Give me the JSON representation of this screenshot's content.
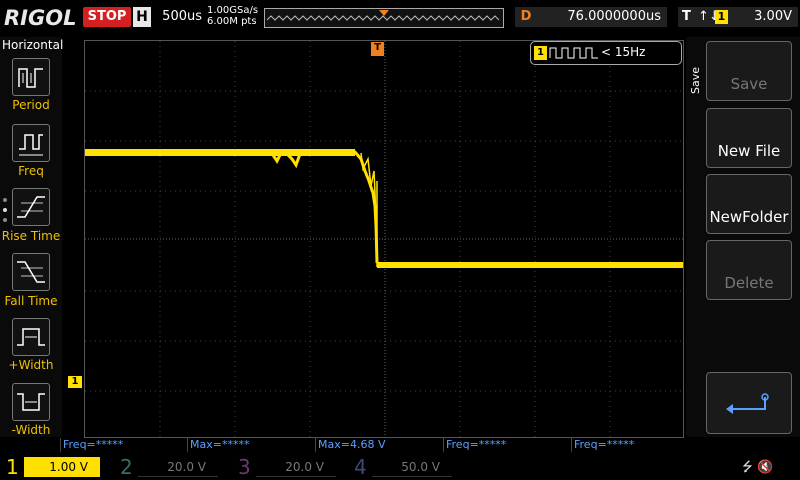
{
  "topbar": {
    "logo": "RIGOL",
    "run_state": "STOP",
    "horizontal_label": "H",
    "timebase": "500us",
    "sample_rate": "1.00GSa/s",
    "memory_depth": "6.00M pts",
    "delay_label": "D",
    "delay_value": "76.0000000us",
    "trigger_label": "T",
    "trigger_edge": "↑↓",
    "trigger_channel": "1",
    "trigger_level": "3.00V"
  },
  "left_menu": {
    "title": "Horizontal",
    "items": [
      {
        "label": "Period"
      },
      {
        "label": "Freq"
      },
      {
        "label": "Rise Time"
      },
      {
        "label": "Fall Time"
      },
      {
        "label": "+Width"
      },
      {
        "label": "-Width"
      }
    ]
  },
  "right_menu": {
    "title": "Save",
    "buttons": [
      {
        "label": "Save",
        "enabled": false
      },
      {
        "label": "New File",
        "enabled": true
      },
      {
        "label": "NewFolder",
        "enabled": true
      },
      {
        "label": "Delete",
        "enabled": false
      }
    ]
  },
  "freq_counter": {
    "channel": "1",
    "value": "< 15Hz"
  },
  "markers": {
    "trigger_position": "T",
    "channel1_ground": "1"
  },
  "measurements": [
    {
      "text": "Freq=*****",
      "color": "blue"
    },
    {
      "text": "Max=*****",
      "color": "blue"
    },
    {
      "text": "Max=4.68 V",
      "color": "yellow"
    },
    {
      "text": "Freq=*****",
      "color": "blue"
    },
    {
      "text": "Freq=*****",
      "color": "blue"
    }
  ],
  "channels": [
    {
      "number": "1",
      "scale": "1.00 V",
      "color": "#ffe000",
      "active": true
    },
    {
      "number": "2",
      "scale": "20.0 V",
      "color": "#00d0d0",
      "active": false
    },
    {
      "number": "3",
      "scale": "20.0 V",
      "color": "#d040d0",
      "active": false
    },
    {
      "number": "4",
      "scale": "50.0 V",
      "color": "#3080ff",
      "active": false
    }
  ],
  "colors": {
    "trace": "#ffe000",
    "trigger": "#f08020",
    "stop": "#d42020"
  }
}
